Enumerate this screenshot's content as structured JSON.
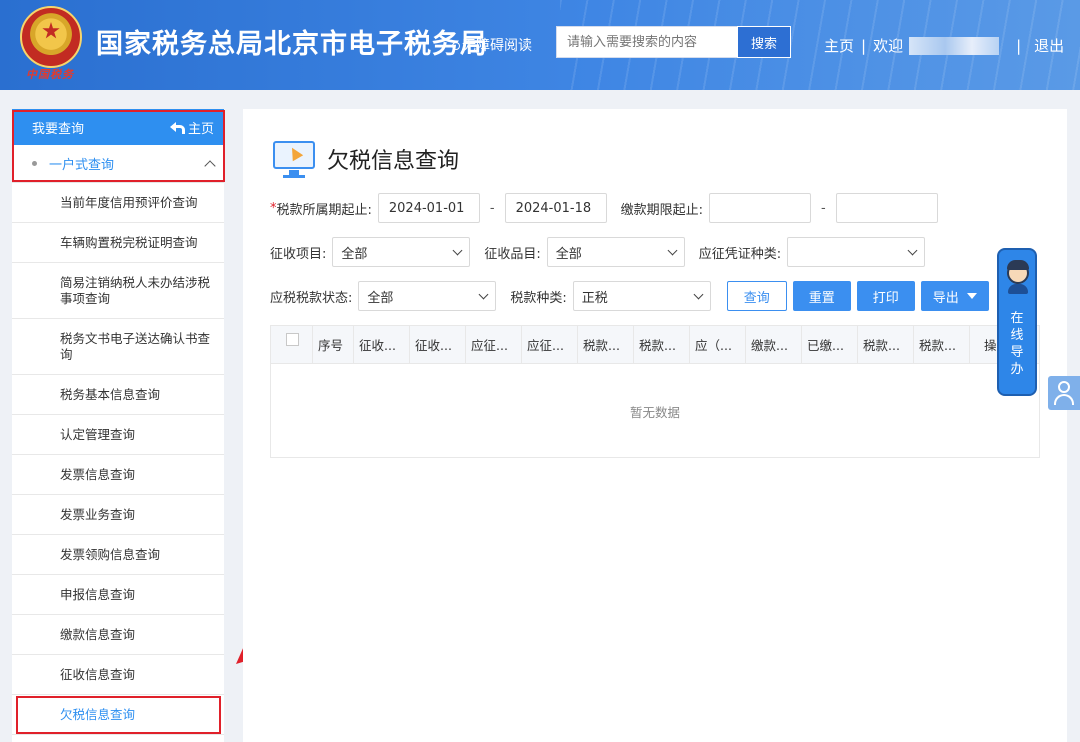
{
  "header": {
    "emblem_caption": "中国税务",
    "title": "国家税务总局北京市电子税务局",
    "accessibility": "无障碍阅读",
    "search": {
      "placeholder": "请输入需要搜索的内容",
      "button": "搜索"
    },
    "nav": {
      "home": "主页",
      "sep": "|",
      "welcome": "欢迎",
      "logout": "退出"
    }
  },
  "sidebar": {
    "head": {
      "title": "我要查询",
      "home": "主页"
    },
    "group": {
      "label": "一户式查询"
    },
    "items": [
      {
        "label": "当前年度信用预评价查询"
      },
      {
        "label": "车辆购置税完税证明查询"
      },
      {
        "label": "简易注销纳税人未办结涉税事项查询"
      },
      {
        "label": "税务文书电子送达确认书查询"
      },
      {
        "label": "税务基本信息查询"
      },
      {
        "label": "认定管理查询"
      },
      {
        "label": "发票信息查询"
      },
      {
        "label": "发票业务查询"
      },
      {
        "label": "发票领购信息查询"
      },
      {
        "label": "申报信息查询"
      },
      {
        "label": "缴款信息查询"
      },
      {
        "label": "征收信息查询"
      },
      {
        "label": "欠税信息查询"
      }
    ]
  },
  "main": {
    "title": "欠税信息查询",
    "form": {
      "required_mark": "*",
      "period_label": "税款所属期起止:",
      "period_start": "2024-01-01",
      "period_end": "2024-01-18",
      "dash": "-",
      "deadline_label": "缴款期限起止:",
      "deadline_start": "",
      "deadline_end": "",
      "levy_item_label": "征收项目:",
      "levy_item_value": "全部",
      "levy_product_label": "征收品目:",
      "levy_product_value": "全部",
      "voucher_type_label": "应征凭证种类:",
      "voucher_type_value": "",
      "status_label": "应税税款状态:",
      "status_value": "全部",
      "tax_type_label": "税款种类:",
      "tax_type_value": "正税"
    },
    "buttons": {
      "query": "查询",
      "reset": "重置",
      "print": "打印",
      "export": "导出"
    },
    "table": {
      "headers": [
        "序号",
        "征收...",
        "征收...",
        "应征...",
        "应征...",
        "税款...",
        "税款...",
        "应（...",
        "缴款...",
        "已缴...",
        "税款...",
        "税款...",
        "操"
      ],
      "empty": "暂无数据"
    }
  },
  "widgets": {
    "online_guide": "在线导办"
  },
  "colors": {
    "header": "#2a6fd0",
    "accent": "#2e8ff0",
    "annotation": "#e0202a"
  },
  "icons": [
    "national-emblem-icon",
    "back-arrow-icon",
    "chevron-up-icon",
    "monitor-cursor-icon",
    "chevron-down-icon",
    "caret-down-icon",
    "checkbox-icon",
    "customer-service-icon",
    "guide-avatar-icon"
  ]
}
